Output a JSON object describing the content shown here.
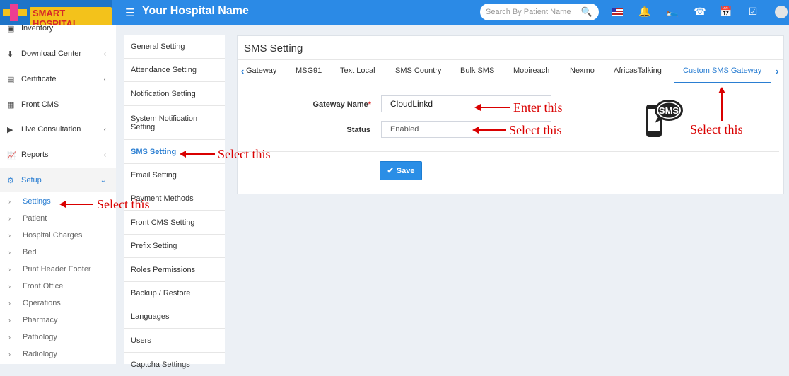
{
  "header": {
    "logo_text": "SMART HOSPITAL",
    "hospital_name": "Your Hospital Name",
    "search_placeholder": "Search By Patient Name"
  },
  "sidebar": {
    "items": [
      {
        "label": "Inventory",
        "icon": "inventory-icon"
      },
      {
        "label": "Download Center",
        "icon": "download-icon"
      },
      {
        "label": "Certificate",
        "icon": "certificate-icon"
      },
      {
        "label": "Front CMS",
        "icon": "front-cms-icon"
      },
      {
        "label": "Live Consultation",
        "icon": "video-icon"
      },
      {
        "label": "Reports",
        "icon": "reports-icon"
      },
      {
        "label": "Setup",
        "icon": "setup-icon"
      }
    ],
    "subitems": [
      "Settings",
      "Patient",
      "Hospital Charges",
      "Bed",
      "Print Header Footer",
      "Front Office",
      "Operations",
      "Pharmacy",
      "Pathology",
      "Radiology"
    ]
  },
  "settings_menu": [
    "General Setting",
    "Attendance Setting",
    "Notification Setting",
    "System Notification Setting",
    "SMS Setting",
    "Email Setting",
    "Payment Methods",
    "Front CMS Setting",
    "Prefix Setting",
    "Roles Permissions",
    "Backup / Restore",
    "Languages",
    "Users",
    "Captcha Settings"
  ],
  "panel": {
    "title": "SMS Setting",
    "tabs": [
      "Gateway",
      "MSG91",
      "Text Local",
      "SMS Country",
      "Bulk SMS",
      "Mobireach",
      "Nexmo",
      "AfricasTalking",
      "Custom SMS Gateway"
    ],
    "gateway_label": "Gateway Name",
    "gateway_value": "CloudLinkd",
    "status_label": "Status",
    "status_value": "Enabled",
    "save_label": "Save",
    "sms_icon_text": "SMS"
  },
  "annotations": {
    "select_this": "Select this",
    "enter_this": "Enter this"
  },
  "colors": {
    "topbar": "#2b8ae6",
    "accent": "#2a7ed2",
    "annotation": "#d90000"
  }
}
